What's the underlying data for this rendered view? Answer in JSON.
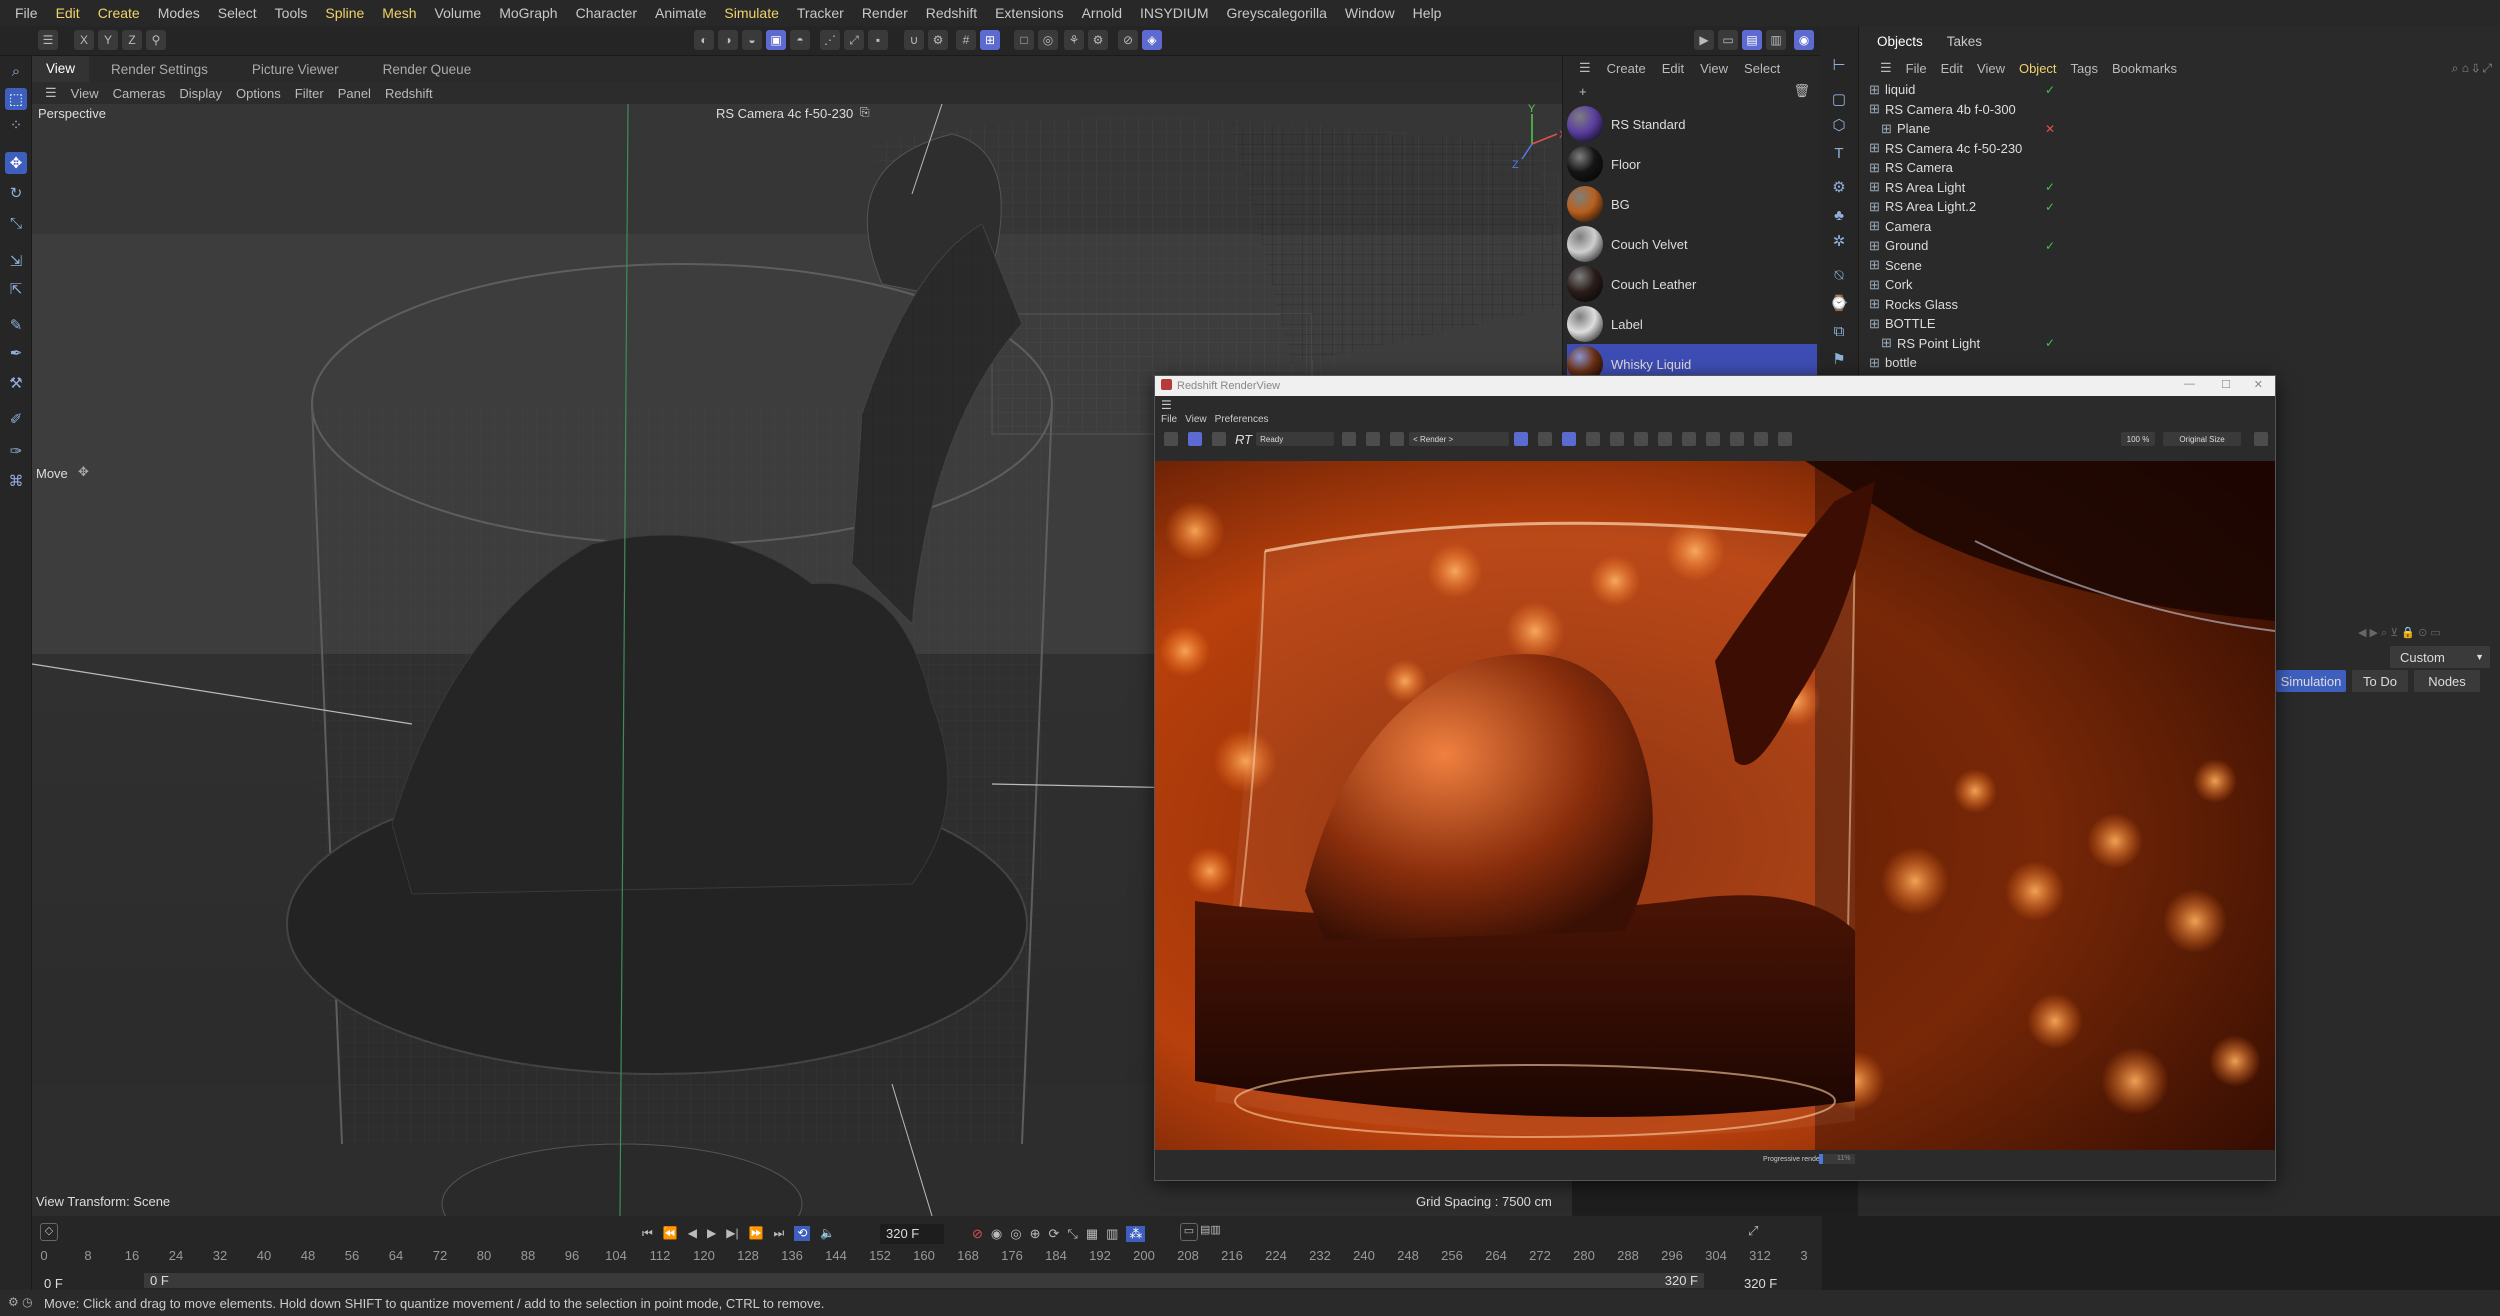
{
  "menubar": {
    "items": [
      {
        "label": "File",
        "hl": false
      },
      {
        "label": "Edit",
        "hl": true
      },
      {
        "label": "Create",
        "hl": true
      },
      {
        "label": "Modes",
        "hl": false
      },
      {
        "label": "Select",
        "hl": false
      },
      {
        "label": "Tools",
        "hl": false
      },
      {
        "label": "Spline",
        "hl": true
      },
      {
        "label": "Mesh",
        "hl": true
      },
      {
        "label": "Volume",
        "hl": false
      },
      {
        "label": "MoGraph",
        "hl": false
      },
      {
        "label": "Character",
        "hl": false
      },
      {
        "label": "Animate",
        "hl": false
      },
      {
        "label": "Simulate",
        "hl": true
      },
      {
        "label": "Tracker",
        "hl": false
      },
      {
        "label": "Render",
        "hl": false
      },
      {
        "label": "Redshift",
        "hl": false
      },
      {
        "label": "Extensions",
        "hl": false
      },
      {
        "label": "Arnold",
        "hl": false
      },
      {
        "label": "INSYDIUM",
        "hl": false
      },
      {
        "label": "Greyscalegorilla",
        "hl": false
      },
      {
        "label": "Window",
        "hl": false
      },
      {
        "label": "Help",
        "hl": false
      }
    ]
  },
  "axis_toggles": [
    "X",
    "Y",
    "Z"
  ],
  "viewport_tabs": [
    "View",
    "Render Settings",
    "Picture Viewer",
    "Render Queue"
  ],
  "viewport_menu": [
    "View",
    "Cameras",
    "Display",
    "Options",
    "Filter",
    "Panel",
    "Redshift"
  ],
  "viewport": {
    "projection": "Perspective",
    "camera": "RS Camera 4c f-50-230",
    "tool_label": "Move",
    "view_transform": "View Transform: Scene",
    "grid_spacing": "Grid Spacing : 7500 cm"
  },
  "material_menu": [
    "Create",
    "Edit",
    "View",
    "Select"
  ],
  "materials": [
    {
      "name": "RS Standard",
      "color": "#5b3fa0"
    },
    {
      "name": "Floor",
      "color": "#151515"
    },
    {
      "name": "BG",
      "color": "#b9601e"
    },
    {
      "name": "Couch Velvet",
      "color": "#cfcfcf"
    },
    {
      "name": "Couch Leather",
      "color": "#2a1d1a"
    },
    {
      "name": "Label",
      "color": "#dedede"
    },
    {
      "name": "Whisky Liquid",
      "color": "#6b2f12"
    }
  ],
  "objects_tabs": [
    "Objects",
    "Takes"
  ],
  "objects_menu": [
    {
      "label": "File",
      "hl": false
    },
    {
      "label": "Edit",
      "hl": false
    },
    {
      "label": "View",
      "hl": false
    },
    {
      "label": "Object",
      "hl": true
    },
    {
      "label": "Tags",
      "hl": false
    },
    {
      "label": "Bookmarks",
      "hl": false
    }
  ],
  "objects": [
    {
      "name": "liquid",
      "indent": 0,
      "check": "✓"
    },
    {
      "name": "RS Camera 4b f-0-300",
      "indent": 0,
      "check": ""
    },
    {
      "name": "Plane",
      "indent": 1,
      "check": "✕"
    },
    {
      "name": "RS Camera 4c f-50-230",
      "indent": 0,
      "check": ""
    },
    {
      "name": "RS Camera",
      "indent": 0,
      "check": ""
    },
    {
      "name": "RS Area Light",
      "indent": 0,
      "check": "✓"
    },
    {
      "name": "RS Area Light.2",
      "indent": 0,
      "check": "✓"
    },
    {
      "name": "Camera",
      "indent": 0,
      "check": ""
    },
    {
      "name": "Ground",
      "indent": 0,
      "check": "✓"
    },
    {
      "name": "Scene",
      "indent": 0,
      "check": ""
    },
    {
      "name": "Cork",
      "indent": 0,
      "check": ""
    },
    {
      "name": "Rocks Glass",
      "indent": 0,
      "check": ""
    },
    {
      "name": "BOTTLE",
      "indent": 0,
      "check": ""
    },
    {
      "name": "RS Point Light",
      "indent": 1,
      "check": "✓"
    },
    {
      "name": "bottle",
      "indent": 0,
      "check": ""
    }
  ],
  "attributes": {
    "layout_select": "Custom",
    "tabs": [
      "Simulation",
      "To Do",
      "Nodes"
    ]
  },
  "renderview": {
    "title": "Redshift RenderView",
    "menu": [
      "File",
      "View",
      "Preferences"
    ],
    "status_select": "Ready",
    "rt_label": "RT",
    "aov_select": "< Render >",
    "zoom": "100 %",
    "size_select": "Original Size",
    "progress_label": "Progressive rendering",
    "progress_value": "11%",
    "progress_fraction": 0.11
  },
  "timeline": {
    "ticks": [
      "0",
      "8",
      "16",
      "24",
      "32",
      "40",
      "48",
      "56",
      "64",
      "72",
      "80",
      "88",
      "96",
      "104",
      "112",
      "120",
      "128",
      "136",
      "144",
      "152",
      "160",
      "168",
      "176",
      "184",
      "192",
      "200",
      "208",
      "216",
      "224",
      "232",
      "240",
      "248",
      "256",
      "264",
      "272",
      "280",
      "288",
      "296",
      "304",
      "312",
      "3"
    ],
    "current_frame": "320 F",
    "start_frame": "0 F",
    "range_start": "0 F",
    "range_end": "320 F",
    "end_frame": "320 F"
  },
  "statusbar": {
    "text": "Move: Click and drag to move elements. Hold down SHIFT to quantize movement / add to the selection in point mode, CTRL to remove."
  }
}
